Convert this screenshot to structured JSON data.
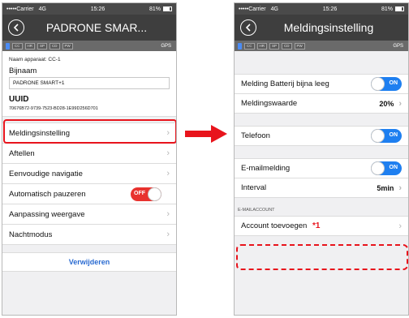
{
  "colors": {
    "nav_bg": "#3e3e3e",
    "toggle_on": "#1e7ff0",
    "toggle_off": "#e8322e",
    "highlight": "#e8141c",
    "link": "#2a6bd1"
  },
  "status_bar": {
    "carrier": "•••••Carrier",
    "network": "4G",
    "time": "15:26",
    "battery": "81%"
  },
  "sensor_bar": {
    "chips": [
      "CC",
      "HR",
      "SP",
      "CD",
      "PW"
    ],
    "gps": "GPS"
  },
  "left_screen": {
    "title": "PADRONE SMAR...",
    "device_line": "Naam apparaat:  CC-1",
    "nickname_label": "Bijnaam",
    "nickname_value": "PADRONE SMART+1",
    "uuid_label": "UUID",
    "uuid_value": "70676B72-9739-7523-BD28-1E99D256D701",
    "menu": [
      {
        "label": "Meldingsinstelling"
      },
      {
        "label": "Aftellen"
      },
      {
        "label": "Eenvoudige navigatie"
      },
      {
        "label": "Automatisch pauzeren",
        "toggle": "OFF"
      },
      {
        "label": "Aanpassing weergave"
      },
      {
        "label": "Nachtmodus"
      }
    ],
    "delete_label": "Verwijderen"
  },
  "right_screen": {
    "title": "Meldingsinstelling",
    "battery_alert_label": "Melding Batterij bijna leeg",
    "battery_alert_toggle": "ON",
    "notify_value_label": "Meldingswaarde",
    "notify_value": "20%",
    "phone_label": "Telefoon",
    "phone_toggle": "ON",
    "email_label": "E-mailmelding",
    "email_toggle": "ON",
    "interval_label": "Interval",
    "interval_value": "5min",
    "section_header": "E-MAILACCOUNT",
    "add_account_label": "Account toevoegen",
    "note_mark": "*1"
  }
}
